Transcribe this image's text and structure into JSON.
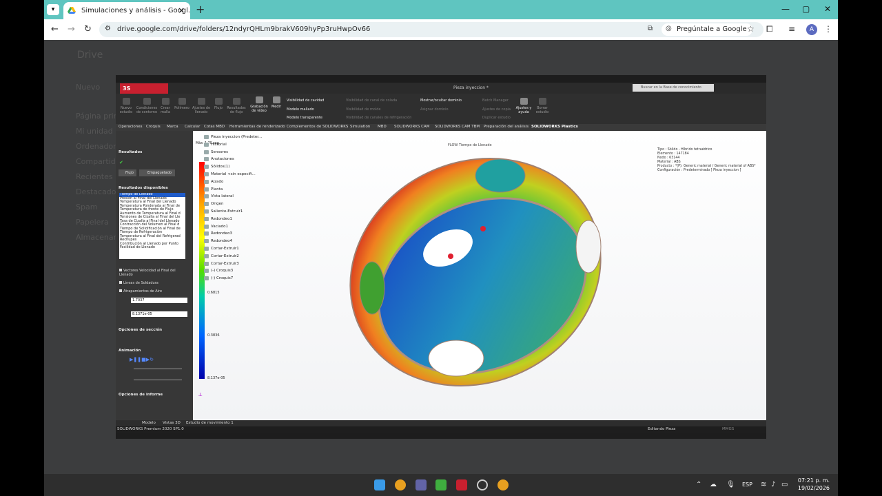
{
  "browser": {
    "tab_title": "Simulaciones y análisis - Googl...",
    "url": "drive.google.com/drive/folders/12ndyrQHLm9brakV609hyPp3ruHwpOv66",
    "ask_google": "Pregúntale a Google",
    "avatar_letter": "A"
  },
  "drive_ghost": {
    "logo": "Drive",
    "new_button": "Nuevo",
    "side": [
      "Página principal",
      "Mi unidad",
      "Ordenadores",
      "Compartido conmigo",
      "Recientes",
      "Destacados",
      "Spam",
      "Papelera",
      "Almacenamiento"
    ]
  },
  "solidworks": {
    "logo": "3S SOLIDWORKS",
    "doc_title": "Pieza inyeccion *",
    "search_placeholder": "Buscar en la Base de conocimiento",
    "ribbon": [
      {
        "label": "Nuevo estudio",
        "on": false
      },
      {
        "label": "Condiciones de contorno",
        "on": false
      },
      {
        "label": "Crear malla",
        "on": false
      },
      {
        "label": "Polímero",
        "on": false
      },
      {
        "label": "Ajustes de llenado",
        "on": false
      },
      {
        "label": "Flujo",
        "on": false
      },
      {
        "label": "Resultados de flujo",
        "on": false
      },
      {
        "label": "Grabación de vídeo",
        "on": true
      },
      {
        "label": "Medir",
        "on": true
      }
    ],
    "ribbon_col1": [
      "Visibilidad de cavidad",
      "Modelo mallado",
      "Modelo transparente"
    ],
    "ribbon_col2": [
      "Visibilidad de canal de colada",
      "Visibilidad de molde",
      "Visibilidad de canales de refrigeración"
    ],
    "ribbon_col3": [
      "Mostrar/ocultar dominio",
      "Asignar dominio"
    ],
    "ribbon_col4": [
      "Batch Manager",
      "Ajustes de copia",
      "Duplicar estudio"
    ],
    "ribbon_right": [
      "Ajustes y ayuda",
      "Borrar estudio"
    ],
    "tabs": [
      "Operaciones",
      "Croquis",
      "Marca",
      "Calcular",
      "Cotas MBD",
      "Herramientas de renderizado",
      "Complementos de SOLIDWORKS",
      "Simulation",
      "MBD",
      "SOLIDWORKS CAM",
      "SOLIDWORKS CAM TBM",
      "Preparación del análisis",
      "SOLIDWORKS Plastics"
    ],
    "left_panel": {
      "title": "Resultados",
      "flujo": "Flujo",
      "empaquetado": "Empaquetado",
      "results_header": "Resultados disponibles",
      "results": [
        "Tiempo de Llenado",
        "Presión al Final del Llenado",
        "Temperatura al Final del Llenado",
        "Temperatura Ponderada al Final de",
        "Temperatura de frente de Flujo",
        "Aumento de Temperatura al Final d",
        "Tensiones de Cizalla al Final del Lle",
        "Tasa de Cizalla al Final del Llenado",
        "Contracción del Volumen al Final d",
        "Tiempo de Solidificación al Final de",
        "Tiempo de Refrigeración",
        "Temperatura al Final del Refrigerad",
        "Rechupes",
        "Contribución al Llenado por Punto",
        "Facilidad de Llenado"
      ],
      "checks": [
        "Vectores Velocidad al Final del Llenado",
        "Líneas de Soldadura",
        "Atrapamientos de Aire"
      ],
      "value_max": "1.7037",
      "value_min": "8.1371e-05",
      "section_header": "Opciones de sección",
      "animation_header": "Animación",
      "report_header": "Opciones de informe"
    },
    "tree": [
      "Pieza inyeccion (Predeter...",
      "Historial",
      "Sensores",
      "Anotaciones",
      "Sólidos(1)",
      "Material <sin especifi...",
      "Alzado",
      "Planta",
      "Vista lateral",
      "Origen",
      "Saliente-Extruir1",
      "Redondeo1",
      "Vaciado1",
      "Redondeo3",
      "Redondeo4",
      "Cortar-Extruir1",
      "Cortar-Extruir2",
      "Cortar-Extruir3",
      "(-) Croquis3",
      "(-) Croquis7"
    ],
    "colorbar_labels": [
      "0.6815",
      "0.3836",
      "8.137e-05"
    ],
    "colorbar_units": "Máx: 1.70 seg",
    "flow_title": "FLOW Tiempo de Llenado",
    "info": [
      "Tipo : Sólido - Híbrido tetraédrico",
      "Elemento : 147184",
      "Nodo : 63144",
      "Material : ABS",
      "Producto : *(P): Generic material / Generic material of ABS*",
      "Configuración : Predeterminado [ Pieza inyeccion ]"
    ],
    "bottom_tabs": [
      "Modelo",
      "Vistas 3D",
      "Estudio de movimiento 1"
    ],
    "status_left": "SOLIDWORKS Premium 2020 SP1.0",
    "status_mid": "Editando Pieza",
    "status_right": "MMGS"
  },
  "taskbar": {
    "lang": "ESP",
    "time": "07:21 p. m.",
    "date": "19/02/2026"
  }
}
